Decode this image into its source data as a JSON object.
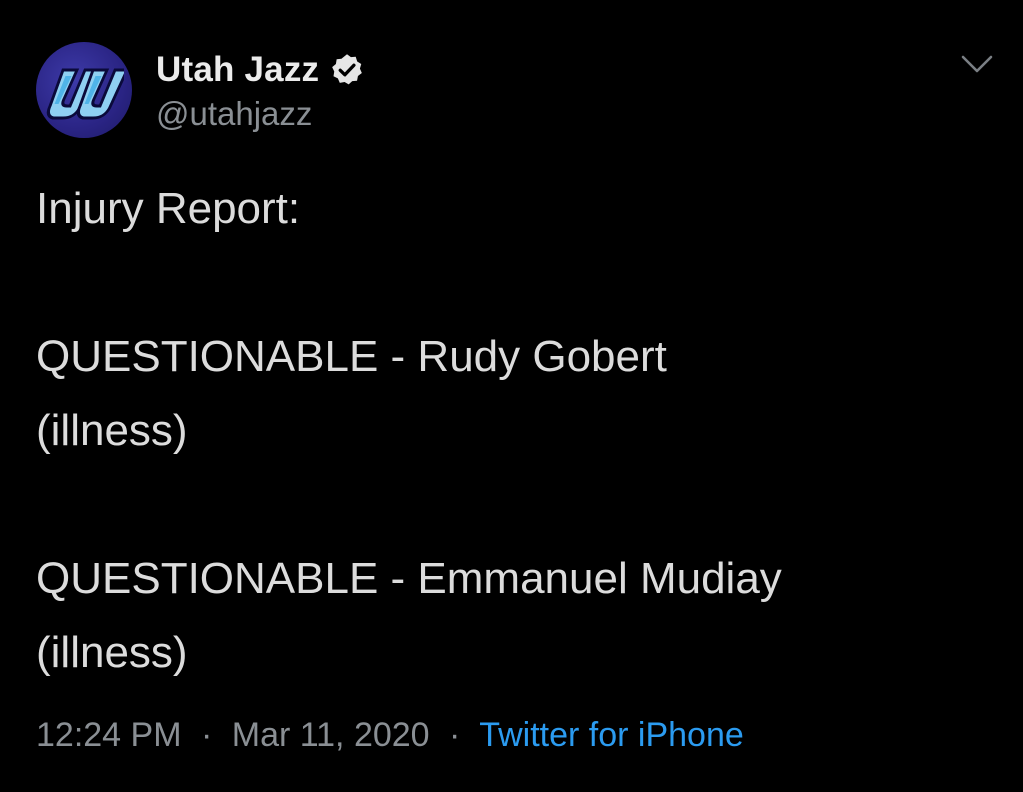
{
  "account": {
    "display_name": "Utah Jazz",
    "handle": "@utahjazz",
    "verified": true,
    "avatar_icon": "utah-jazz-logo",
    "avatar_color": "#2a2484"
  },
  "tweet": {
    "lines": [
      "Injury Report:",
      "",
      "QUESTIONABLE - Rudy Gobert",
      "(illness)",
      "",
      "QUESTIONABLE - Emmanuel Mudiay",
      "(illness)"
    ]
  },
  "meta": {
    "time": "12:24 PM",
    "separator": "·",
    "date": "Mar 11, 2020",
    "source": "Twitter for iPhone",
    "source_color": "#2b9bf0"
  },
  "icons": {
    "verified": "verified-badge-icon",
    "menu": "chevron-down-icon"
  }
}
